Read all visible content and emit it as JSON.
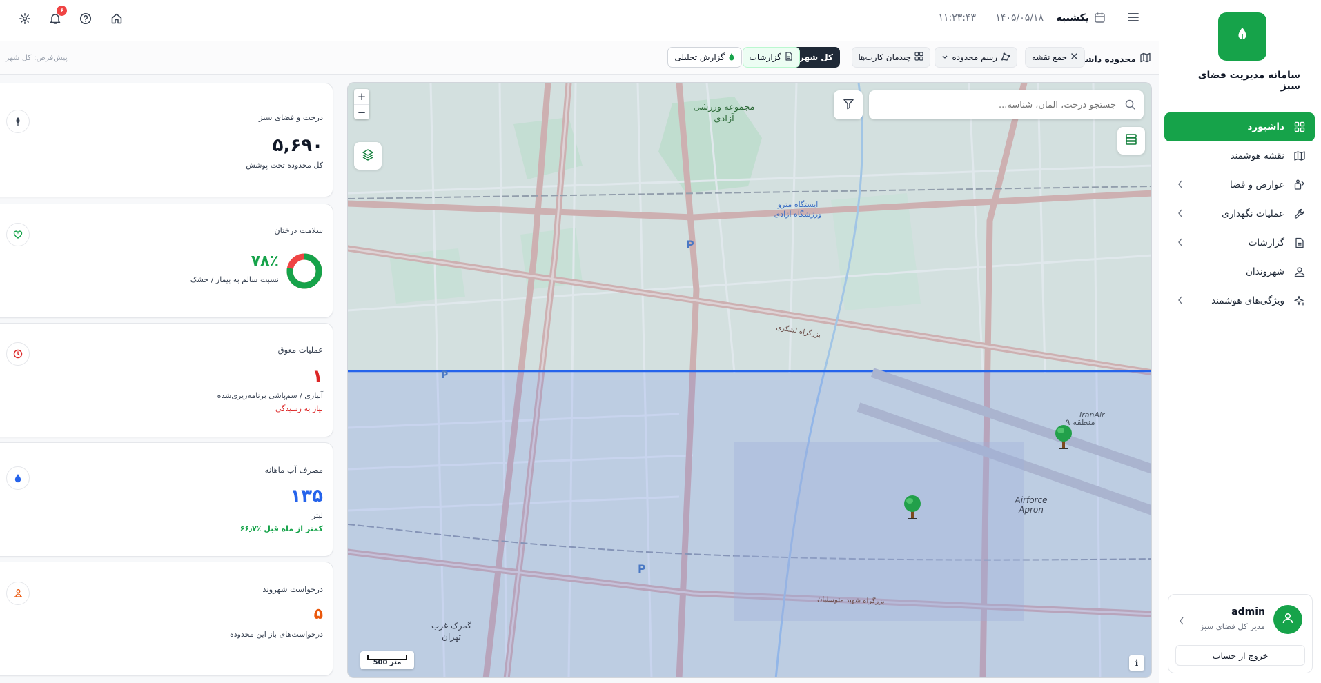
{
  "app": {
    "title": "سامانه مدیریت فضای سبز"
  },
  "sidebar": {
    "items": [
      {
        "label": "داشبورد",
        "icon": "grid-icon",
        "active": true
      },
      {
        "label": "نقشه هوشمند",
        "icon": "map-icon"
      },
      {
        "label": "عوارض و فضا",
        "icon": "feature-icon"
      },
      {
        "label": "عملیات نگهداری",
        "icon": "wrench-icon"
      },
      {
        "label": "گزارشات",
        "icon": "report-icon"
      },
      {
        "label": "شهروندان",
        "icon": "user-icon"
      },
      {
        "label": "ویژگی‌های هوشمند",
        "icon": "sparkle-icon"
      }
    ]
  },
  "user": {
    "name": "admin",
    "role": "مدیر کل فضای سبز",
    "logout_label": "خروج از حساب"
  },
  "header": {
    "day": "یکشنبه",
    "date": "۱۴۰۵/۰۵/۱۸",
    "time": "۱۱:۲۳:۴۳",
    "notifications": "۶"
  },
  "toolbar": {
    "scope_label": "محدوده داشبورد",
    "collapse_map": "جمع نقشه",
    "draw_area": "رسم محدوده",
    "card_layout": "چیدمان کارت‌ها",
    "whole_city": "کل شهر",
    "reports": "گزارشات",
    "analytic_report": "گزارش تحلیلی",
    "default_hint": "پیش‌فرض: کل شهر"
  },
  "map": {
    "search_placeholder": "جستجو درخت، المان، شناسه...",
    "zoom_in": "+",
    "zoom_out": "−",
    "scale_label": "500 متر",
    "info": "i",
    "labels": {
      "sports": "مجموعه ورزشی آزادی",
      "metro": "ایستگاه مترو ورزشگاه آزادی",
      "airfield": "Airforce Apron",
      "iranair": "IranAir",
      "customs": "گمرک غرب تهران",
      "region": "منطقه ۹",
      "highway1": "بزرگراه لشگری",
      "highway2": "بزرگراه شهید متوسلیان"
    }
  },
  "cards": [
    {
      "title": "درخت و فضای سبز",
      "value": "۵,۶۹۰",
      "sub": "کل محدوده تحت پوشش",
      "icon": "sapling-icon"
    },
    {
      "title": "سلامت درختان",
      "value": "۷۸٪",
      "sub": "نسبت سالم به بیمار / خشک",
      "icon": "heart-icon",
      "health_pct": 78
    },
    {
      "title": "عملیات معوق",
      "value": "۱",
      "sub": "آبیاری / سم‌پاشی برنامه‌ریزی‌شده",
      "sub2": "نیاز به رسیدگی",
      "icon": "clock-icon"
    },
    {
      "title": "مصرف آب ماهانه",
      "value": "۱۳۵",
      "sub": "لیتر",
      "sub2": "۶۶٫۷٪ کمتر از ماه قبل",
      "icon": "drop-icon"
    },
    {
      "title": "درخواست شهروند",
      "value": "۵",
      "sub": "درخواست‌های باز این محدوده",
      "icon": "citizen-icon"
    }
  ],
  "colors": {
    "brand": "#16a34a",
    "danger": "#dc2626",
    "water": "#2563eb",
    "orange": "#ea580c",
    "dark": "#111827"
  }
}
